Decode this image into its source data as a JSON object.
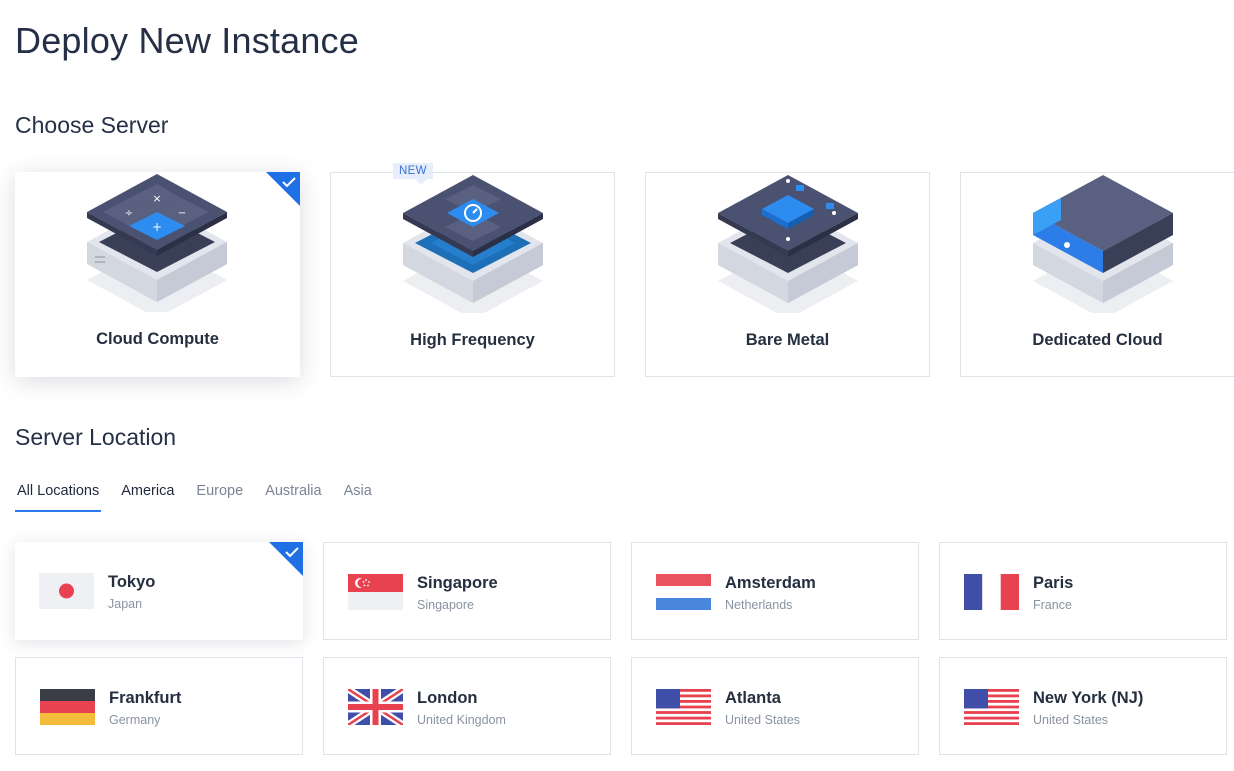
{
  "page": {
    "title": "Deploy New Instance"
  },
  "choose_server": {
    "title": "Choose Server",
    "cards": [
      {
        "label": "Cloud Compute",
        "selected": true,
        "icon": "cloud-compute-icon"
      },
      {
        "label": "High Frequency",
        "selected": false,
        "badge": "NEW",
        "icon": "high-frequency-icon"
      },
      {
        "label": "Bare Metal",
        "selected": false,
        "icon": "bare-metal-icon"
      },
      {
        "label": "Dedicated Cloud",
        "selected": false,
        "icon": "dedicated-cloud-icon"
      }
    ]
  },
  "server_location": {
    "title": "Server Location",
    "tabs": [
      {
        "label": "All Locations",
        "active": true
      },
      {
        "label": "America",
        "active": false
      },
      {
        "label": "Europe",
        "active": false
      },
      {
        "label": "Australia",
        "active": false
      },
      {
        "label": "Asia",
        "active": false
      }
    ],
    "locations": [
      {
        "city": "Tokyo",
        "country": "Japan",
        "selected": true,
        "flag": "japan-flag-icon"
      },
      {
        "city": "Singapore",
        "country": "Singapore",
        "selected": false,
        "flag": "singapore-flag-icon"
      },
      {
        "city": "Amsterdam",
        "country": "Netherlands",
        "selected": false,
        "flag": "netherlands-flag-icon"
      },
      {
        "city": "Paris",
        "country": "France",
        "selected": false,
        "flag": "france-flag-icon"
      },
      {
        "city": "Frankfurt",
        "country": "Germany",
        "selected": false,
        "flag": "germany-flag-icon"
      },
      {
        "city": "London",
        "country": "United Kingdom",
        "selected": false,
        "flag": "uk-flag-icon"
      },
      {
        "city": "Atlanta",
        "country": "United States",
        "selected": false,
        "flag": "usa-flag-icon"
      },
      {
        "city": "New York (NJ)",
        "country": "United States",
        "selected": false,
        "flag": "usa-flag-icon"
      }
    ]
  },
  "colors": {
    "accent": "#2d78f0",
    "check": "#1f6fe5",
    "title": "#253046"
  }
}
